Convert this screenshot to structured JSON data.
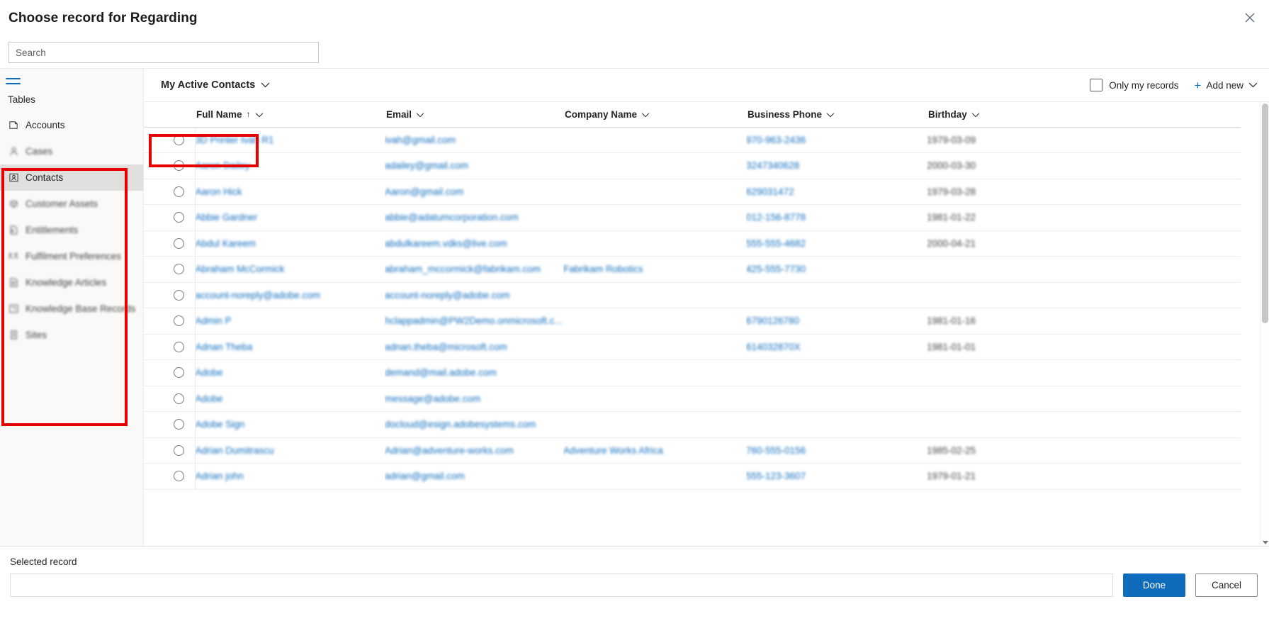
{
  "dialog": {
    "title": "Choose record for Regarding",
    "close_icon": "close-icon"
  },
  "search": {
    "placeholder": "Search",
    "value": ""
  },
  "sidebar": {
    "menu_icon": "hamburger-icon",
    "section_label": "Tables",
    "items": [
      {
        "label": "Accounts",
        "icon": "accounts-icon",
        "blurred": false,
        "active": false
      },
      {
        "label": "Cases",
        "icon": "cases-icon",
        "blurred": true,
        "active": false
      },
      {
        "label": "Contacts",
        "icon": "contacts-icon",
        "blurred": false,
        "active": true
      },
      {
        "label": "Customer Assets",
        "icon": "customer-assets-icon",
        "blurred": true,
        "active": false
      },
      {
        "label": "Entitlements",
        "icon": "entitlements-icon",
        "blurred": true,
        "active": false
      },
      {
        "label": "Fulfilment Preferences",
        "icon": "fulfilment-preferences-icon",
        "blurred": true,
        "active": false
      },
      {
        "label": "Knowledge Articles",
        "icon": "knowledge-articles-icon",
        "blurred": true,
        "active": false
      },
      {
        "label": "Knowledge Base Records",
        "icon": "knowledge-base-records-icon",
        "blurred": true,
        "active": false
      },
      {
        "label": "Sites",
        "icon": "sites-icon",
        "blurred": true,
        "active": false
      }
    ]
  },
  "toolbar": {
    "view_name": "My Active Contacts",
    "view_chevron_icon": "chevron-down-icon",
    "only_my_records_label": "Only my records",
    "only_my_records_checked": false,
    "add_new_label": "Add new",
    "add_new_plus_icon": "plus-icon",
    "add_new_chevron_icon": "chevron-down-icon"
  },
  "grid": {
    "columns": [
      {
        "key": "select",
        "label": "",
        "sorted": false
      },
      {
        "key": "fullname",
        "label": "Full Name",
        "sorted": true,
        "sort_dir": "asc"
      },
      {
        "key": "email",
        "label": "Email",
        "sorted": false
      },
      {
        "key": "company",
        "label": "Company Name",
        "sorted": false
      },
      {
        "key": "phone",
        "label": "Business Phone",
        "sorted": false
      },
      {
        "key": "birthday",
        "label": "Birthday",
        "sorted": false
      }
    ],
    "rows": [
      {
        "fullname": "3D Printer Ivah R1",
        "email": "ivah@gmail.com",
        "company": "",
        "phone": "970-963-2436",
        "birthday": "1979-03-09"
      },
      {
        "fullname": "Aaron Dailey",
        "email": "adailey@gmail.com",
        "company": "",
        "phone": "3247340628",
        "birthday": "2000-03-30"
      },
      {
        "fullname": "Aaron Hick",
        "email": "Aaron@gmail.com",
        "company": "",
        "phone": "629031472",
        "birthday": "1979-03-28"
      },
      {
        "fullname": "Abbie Gardner",
        "email": "abbie@adatumcorporation.com",
        "company": "",
        "phone": "012-156-8778",
        "birthday": "1981-01-22"
      },
      {
        "fullname": "Abdul Kareem",
        "email": "abdulkareem.vdks@live.com",
        "company": "",
        "phone": "555-555-4682",
        "birthday": "2000-04-21"
      },
      {
        "fullname": "Abraham McCormick",
        "email": "abraham_mccormick@fabrikam.com",
        "company": "Fabrikam Robotics",
        "phone": "425-555-7730",
        "birthday": ""
      },
      {
        "fullname": "account-noreply@adobe.com",
        "email": "account-noreply@adobe.com",
        "company": "",
        "phone": "",
        "birthday": ""
      },
      {
        "fullname": "Admin P",
        "email": "hclappadmin@PW2Demo.onmicrosoft.c...",
        "company": "",
        "phone": "6790126780",
        "birthday": "1981-01-16"
      },
      {
        "fullname": "Adnan Theba",
        "email": "adnan.theba@microsoft.com",
        "company": "",
        "phone": "614032870X",
        "birthday": "1981-01-01"
      },
      {
        "fullname": "Adobe",
        "email": "demand@mail.adobe.com",
        "company": "",
        "phone": "",
        "birthday": ""
      },
      {
        "fullname": "Adobe",
        "email": "message@adobe.com",
        "company": "",
        "phone": "",
        "birthday": ""
      },
      {
        "fullname": "Adobe Sign",
        "email": "docloud@esign.adobesystems.com",
        "company": "",
        "phone": "",
        "birthday": ""
      },
      {
        "fullname": "Adrian Dumitrascu",
        "email": "Adrian@adventure-works.com",
        "company": "Adventure Works Africa",
        "phone": "760-555-0156",
        "birthday": "1985-02-25"
      },
      {
        "fullname": "Adrian john",
        "email": "adrian@gmail.com",
        "company": "",
        "phone": "555-123-3607",
        "birthday": "1979-01-21"
      }
    ]
  },
  "footer": {
    "selected_record_label": "Selected record",
    "selected_record_value": "",
    "done_label": "Done",
    "cancel_label": "Cancel"
  },
  "colors": {
    "accent": "#0f6cbd",
    "annotation": "#e60000",
    "link": "#0f6cbd",
    "sidebar_bg": "#faf9f8",
    "active_item_bg": "#e1dfdd"
  }
}
